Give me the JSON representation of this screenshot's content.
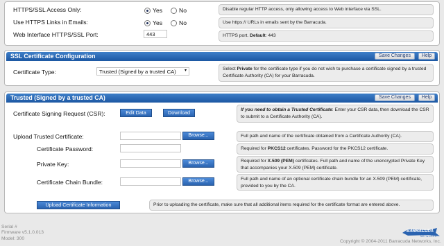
{
  "top": {
    "https_only": {
      "label": "HTTPS/SSL Access Only:",
      "yes": "Yes",
      "no": "No",
      "help": "Disable regular HTTP access, only allowing access to Web interface via SSL."
    },
    "https_links": {
      "label": "Use HTTPS Links in Emails:",
      "yes": "Yes",
      "no": "No",
      "help": "Use https:// URLs in emails sent by the Barracuda."
    },
    "https_port": {
      "label": "Web Interface HTTPS/SSL Port:",
      "value": "443",
      "help_prefix": "HTTPS port. ",
      "help_bold": "Default",
      "help_suffix": ": 443"
    }
  },
  "ssl_config": {
    "title": "SSL Certificate Configuration",
    "save_label": "Save Changes",
    "help_label": "Help",
    "cert_type_label": "Certificate Type:",
    "cert_type_value": "Trusted (Signed by a trusted CA)",
    "help_1": "Select ",
    "help_bold": "Private",
    "help_2": " for the certificate type if you do not wish to purchase a certificate signed by a trusted Certificate Authority (CA) for your Barracuda."
  },
  "trusted": {
    "title": "Trusted (Signed by a trusted CA)",
    "save_label": "Save Changes",
    "help_label": "Help",
    "csr_label": "Certificate Signing Request (CSR):",
    "edit_data": "Edit Data",
    "download": "Download",
    "csr_help_bold": "If you need to obtain a Trusted Certificate",
    "csr_help_rest": ": Enter your CSR data, then download the CSR to submit to a Certificate Authority (CA).",
    "upload_label": "Upload Trusted Certificate:",
    "upload_browse": "Browse...",
    "upload_help": "Full path and name of the certificate obtained from a Certificate Authority (CA).",
    "password_label": "Certificate Password:",
    "password_help_1": "Required for ",
    "password_help_bold": "PKCS12",
    "password_help_2": " certificates. Password for the PKCS12 certificate.",
    "private_key_label": "Private Key:",
    "private_key_browse": "Browse...",
    "private_key_help_1": "Required for ",
    "private_key_help_bold": "X.509 (PEM)",
    "private_key_help_2": " certificates. Full path and name of the unencrypted Private Key that accompanies your X.509 (PEM) certificate.",
    "chain_label": "Certificate Chain Bundle:",
    "chain_browse": "Browse...",
    "chain_help": "Full path and name of an optional certificate chain bundle for an X.509 (PEM) certificate, provided to you by the CA.",
    "upload_info_button": "Upload Certificate Information",
    "upload_info_help": "Prior to uploading the certificate, make sure that all additional items required for the certificate format are entered above."
  },
  "footer": {
    "serial": "Serial #",
    "firmware": "Firmware v5.1.0.013",
    "model": "Model: 300",
    "copyright": "Copyright © 2004-2011 Barracuda Networks, Inc.",
    "logo_text": "BARRACUDA",
    "logo_sub": "NETWORKS"
  },
  "colors": {
    "header_blue": "#1c57a3",
    "help_bg": "#ececec",
    "page_bg": "#e9e9e9"
  }
}
